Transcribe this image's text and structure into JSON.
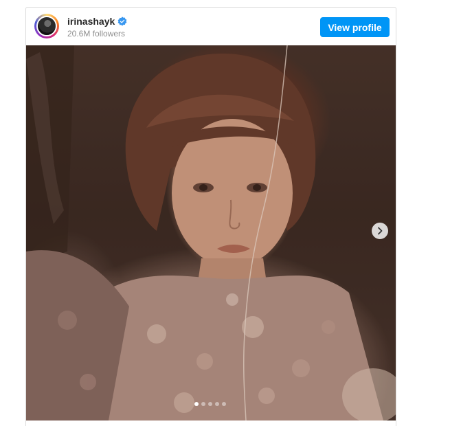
{
  "post": {
    "username": "irinashayk",
    "followers": "20.6M followers",
    "view_profile_label": "View profile",
    "verified": true
  },
  "carousel": {
    "slide_count": 5,
    "active_slide": 1,
    "next_icon": "chevron-right-icon"
  },
  "colors": {
    "button_blue": "#0095f6",
    "verified_blue": "#3897f0",
    "muted_text": "#8e8e8e"
  }
}
